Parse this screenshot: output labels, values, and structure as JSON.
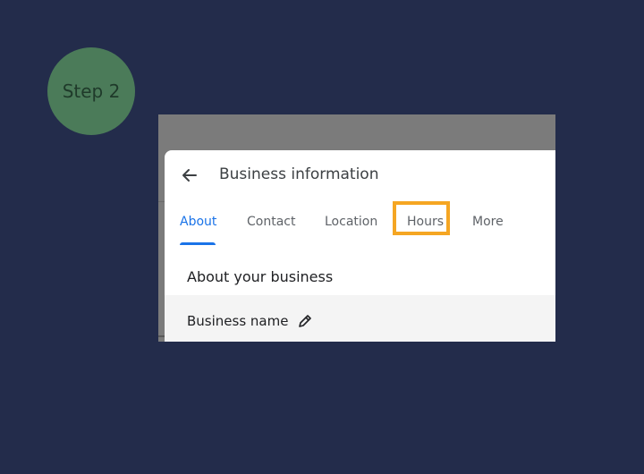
{
  "step": {
    "label": "Step 2"
  },
  "dialog": {
    "title": "Business information",
    "back_icon": "arrow-left-icon",
    "tabs": [
      {
        "label": "About",
        "active": true
      },
      {
        "label": "Contact",
        "active": false
      },
      {
        "label": "Location",
        "active": false
      },
      {
        "label": "Hours",
        "active": false,
        "highlighted": true
      },
      {
        "label": "More",
        "active": false
      }
    ],
    "section_title": "About your business",
    "fields": [
      {
        "label": "Business name",
        "icon": "pencil-icon"
      }
    ]
  },
  "colors": {
    "background": "#232c4b",
    "step_badge": "#4b7b59",
    "active_tab": "#1a73e8",
    "highlight": "#f5a623"
  }
}
